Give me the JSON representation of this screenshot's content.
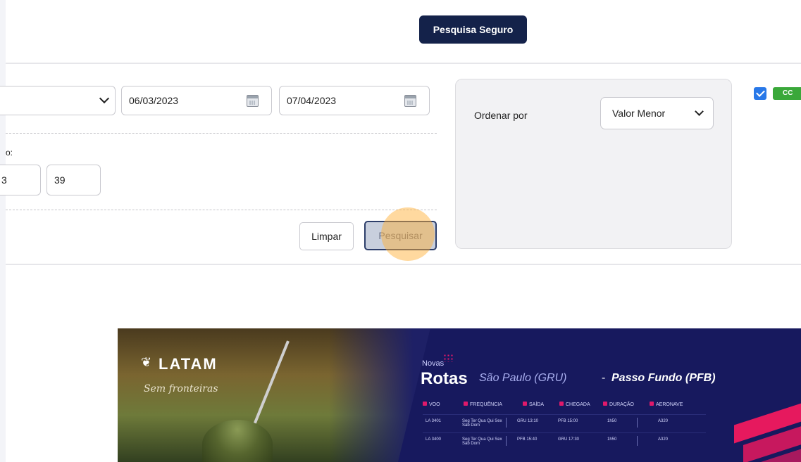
{
  "header": {
    "insurance_button": "Pesquisa Seguro"
  },
  "filters": {
    "start_date": "06/03/2023",
    "end_date": "07/04/2023",
    "field_label_fragment": "o:",
    "num_field_1": "3",
    "num_field_2": "39",
    "clear_button": "Limpar",
    "search_button": "Pesquisar"
  },
  "sort": {
    "label": "Ordenar por",
    "selected": "Valor Menor"
  },
  "right_column": {
    "checkbox_checked": true,
    "badge_fragment": "CC",
    "accent_green": "#3aa83a"
  },
  "banner": {
    "brand": "LATAM",
    "tagline": "Sem fronteiras",
    "novas": "Novas",
    "rotas": "Rotas",
    "route_from": "São Paulo (GRU)",
    "route_sep": "-",
    "route_to": "Passo Fundo (PFB)",
    "columns": [
      "VOO",
      "FREQUÊNCIA",
      "SAÍDA",
      "CHEGADA",
      "DURAÇÃO",
      "AERONAVE"
    ],
    "rows": [
      {
        "voo": "LA 3401",
        "frequencia": "Seg Ter Qua Qui Sex Sáb Dom",
        "saida": "GRU 13:10",
        "chegada": "PFB 15:00",
        "duracao": "1h50",
        "aeronave": "A320"
      },
      {
        "voo": "LA 3400",
        "frequencia": "Seg Ter Qua Qui Sex Sáb Dom",
        "saida": "PFB 15:40",
        "chegada": "GRU 17:30",
        "duracao": "1h50",
        "aeronave": "A320"
      }
    ],
    "colors": {
      "navy": "#17195e",
      "magenta": "#e6195e"
    }
  },
  "colors": {
    "primary_navy": "#14224a",
    "checkbox_blue": "#2878e8"
  }
}
